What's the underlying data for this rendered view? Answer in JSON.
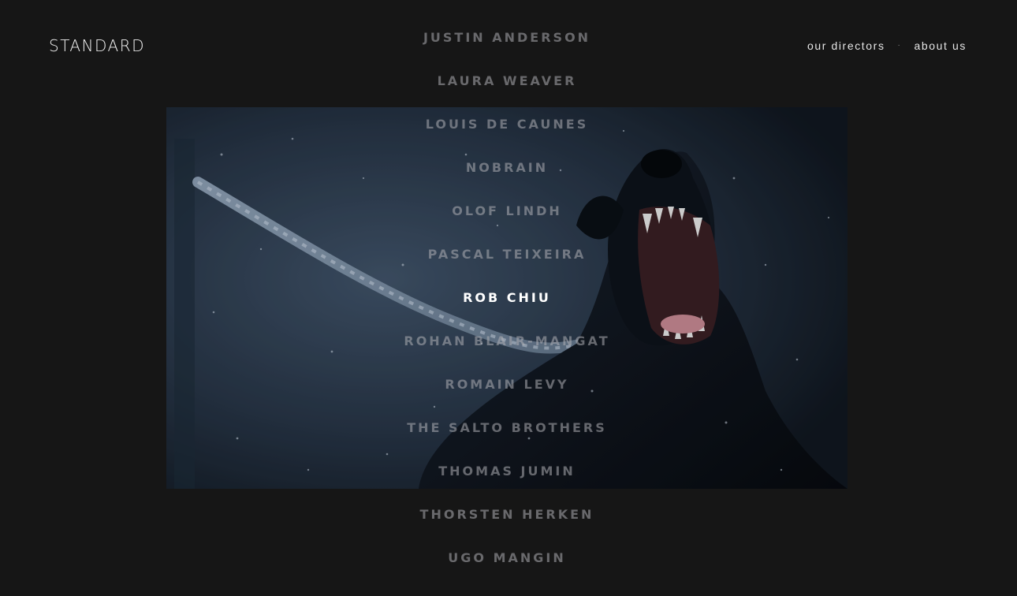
{
  "brand": {
    "logo_text": "STANDARD"
  },
  "nav": {
    "directors_label": "our directors",
    "separator": "·",
    "about_label": "about us"
  },
  "hero": {
    "subject": "snarling dog on leash in snow"
  },
  "directors": [
    {
      "name": "JUSTIN ANDERSON",
      "active": false
    },
    {
      "name": "LAURA WEAVER",
      "active": false
    },
    {
      "name": "LOUIS DE CAUNES",
      "active": false
    },
    {
      "name": "NOBRAIN",
      "active": false
    },
    {
      "name": "OLOF LINDH",
      "active": false
    },
    {
      "name": "PASCAL TEIXEIRA",
      "active": false
    },
    {
      "name": "ROB CHIU",
      "active": true
    },
    {
      "name": "ROHAN BLAIR-MANGAT",
      "active": false
    },
    {
      "name": "ROMAIN LEVY",
      "active": false
    },
    {
      "name": "THE SALTO BROTHERS",
      "active": false
    },
    {
      "name": "THOMAS JUMIN",
      "active": false
    },
    {
      "name": "THORSTEN HERKEN",
      "active": false
    },
    {
      "name": "UGO MANGIN",
      "active": false
    }
  ],
  "colors": {
    "background": "#161616",
    "active_text": "#ffffff",
    "inactive_text": "#afafb4"
  }
}
